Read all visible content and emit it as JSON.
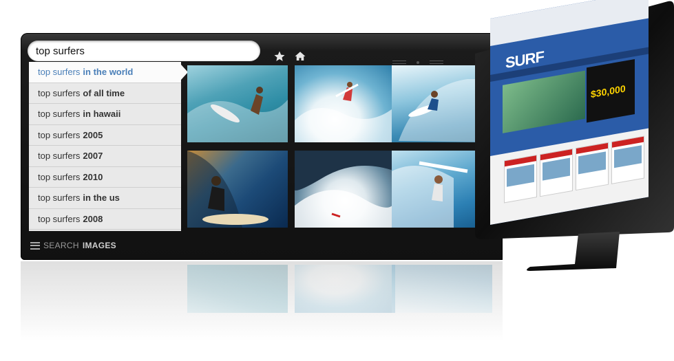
{
  "search": {
    "value": "top surfers",
    "prefix": "top surfers"
  },
  "toolbar": {
    "favorite_icon": "star-icon",
    "home_icon": "home-icon"
  },
  "suggestions": [
    {
      "suffix": "in the world",
      "active": true
    },
    {
      "suffix": "of all time",
      "active": false
    },
    {
      "suffix": "in hawaii",
      "active": false
    },
    {
      "suffix": "2005",
      "active": false
    },
    {
      "suffix": "2007",
      "active": false
    },
    {
      "suffix": "2010",
      "active": false
    },
    {
      "suffix": "in the us",
      "active": false
    },
    {
      "suffix": "2008",
      "active": false
    }
  ],
  "footer": {
    "search_label": "SEARCH",
    "images_label": "IMAGES",
    "menu_icon": "menu-icon"
  },
  "monitor": {
    "logo_text": "SURF",
    "ad_text": "$30,000"
  },
  "colors": {
    "active_suggestion": "#4a7fb8",
    "panel": "#111111"
  }
}
